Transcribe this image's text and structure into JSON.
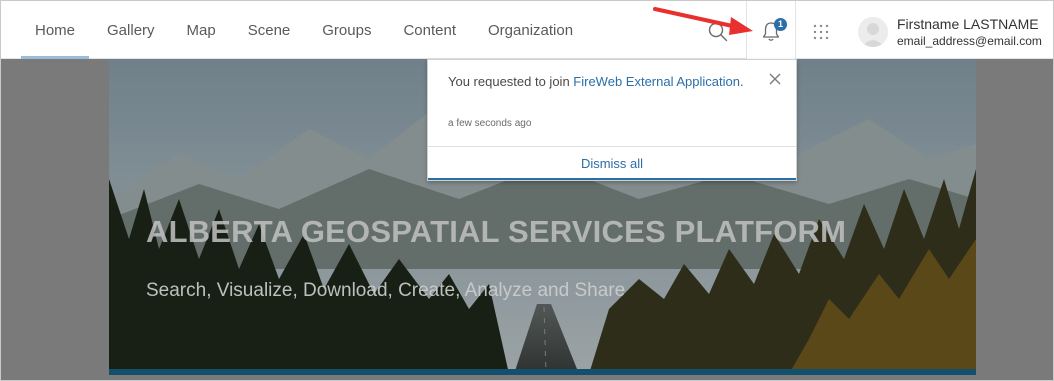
{
  "nav": {
    "tabs": [
      {
        "label": "Home",
        "active": true
      },
      {
        "label": "Gallery",
        "active": false
      },
      {
        "label": "Map",
        "active": false
      },
      {
        "label": "Scene",
        "active": false
      },
      {
        "label": "Groups",
        "active": false
      },
      {
        "label": "Content",
        "active": false
      },
      {
        "label": "Organization",
        "active": false
      }
    ]
  },
  "header": {
    "notification_count": "1",
    "user_name": "Firstname LASTNAME",
    "user_email": "email_address@email.com",
    "icons": [
      "search-icon",
      "bell-icon",
      "apps-grid-icon",
      "avatar-icon"
    ]
  },
  "notification": {
    "message_prefix": "You requested to join ",
    "message_link": "FireWeb External Application",
    "message_suffix": ".",
    "time": "a few seconds ago",
    "dismiss_label": "Dismiss all"
  },
  "banner": {
    "title": "ALBERTA GEOSPATIAL SERVICES PLATFORM",
    "subtitle": "Search, Visualize, Download, Create, Analyze and Share"
  },
  "colors": {
    "accent": "#2b6ea8",
    "active_tab_underline": "#9bbcd6",
    "annotation_arrow": "#e8312f",
    "banner_bottom_bar": "#12506e"
  }
}
